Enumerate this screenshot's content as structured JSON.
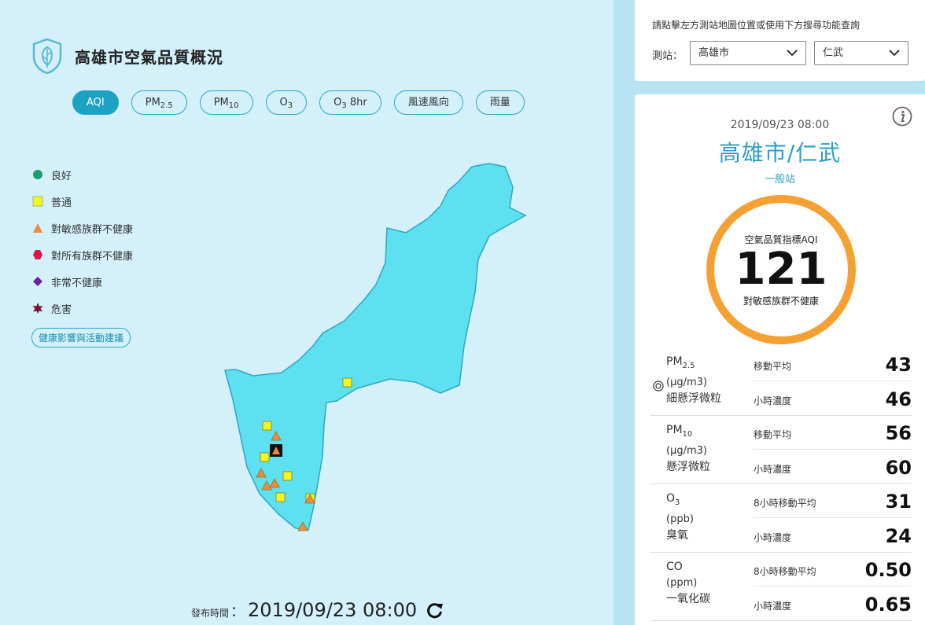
{
  "header": {
    "title": "高雄市空氣品質概況"
  },
  "tabs": [
    {
      "label": "AQI",
      "active": true
    },
    {
      "label": "PM",
      "sub": "2.5"
    },
    {
      "label": "PM",
      "sub": "10"
    },
    {
      "label": "O",
      "sub": "3"
    },
    {
      "label": "O",
      "sub": "3",
      "suffix": " 8hr"
    },
    {
      "label": "風速風向"
    },
    {
      "label": "雨量"
    }
  ],
  "legend": {
    "items": [
      {
        "label": "良好",
        "icon": "circle-icon",
        "color": "#1a9e6f"
      },
      {
        "label": "普通",
        "icon": "square-icon",
        "color": "#f4f41e"
      },
      {
        "label": "對敏感族群不健康",
        "icon": "triangle-icon",
        "color": "#f08a3c"
      },
      {
        "label": "對所有族群不健康",
        "icon": "hexagon-icon",
        "color": "#d8164a"
      },
      {
        "label": "非常不健康",
        "icon": "diamond-icon",
        "color": "#6a1fa0"
      },
      {
        "label": "危害",
        "icon": "star-icon",
        "color": "#7a1030"
      }
    ],
    "health_button": "健康影響與活動建議"
  },
  "publish": {
    "label": "發布時間",
    "sep": "：",
    "time": "2019/09/23 08:00"
  },
  "search": {
    "hint": "請點擊左方測站地圖位置或使用下方搜尋功能查詢",
    "station_label": "測站：",
    "city": "高雄市",
    "site": "仁武"
  },
  "station": {
    "datetime": "2019/09/23 08:00",
    "name": "高雄市/仁武",
    "type": "一般站",
    "aqi_label": "空氣品質指標AQI",
    "aqi": "121",
    "status": "對敏感族群不健康",
    "status_color": "#f5a032"
  },
  "pollutants": [
    {
      "name": "PM",
      "sub": "2.5",
      "unit": "(μg/m3)",
      "desc": "細懸浮微粒",
      "r1_label": "移動平均",
      "r1_val": "43",
      "r2_label": "小時濃度",
      "r2_val": "46",
      "target": true
    },
    {
      "name": "PM",
      "sub": "10",
      "unit": "(μg/m3)",
      "desc": "懸浮微粒",
      "r1_label": "移動平均",
      "r1_val": "56",
      "r2_label": "小時濃度",
      "r2_val": "60"
    },
    {
      "name": "O",
      "sub": "3",
      "unit": "(ppb)",
      "desc": "臭氧",
      "r1_label": "8小時移動平均",
      "r1_val": "31",
      "r2_label": "小時濃度",
      "r2_val": "24"
    },
    {
      "name": "CO",
      "sub": "",
      "unit": "(ppm)",
      "desc": "一氧化碳",
      "r1_label": "8小時移動平均",
      "r1_val": "0.50",
      "r2_label": "小時濃度",
      "r2_val": "0.65"
    }
  ]
}
